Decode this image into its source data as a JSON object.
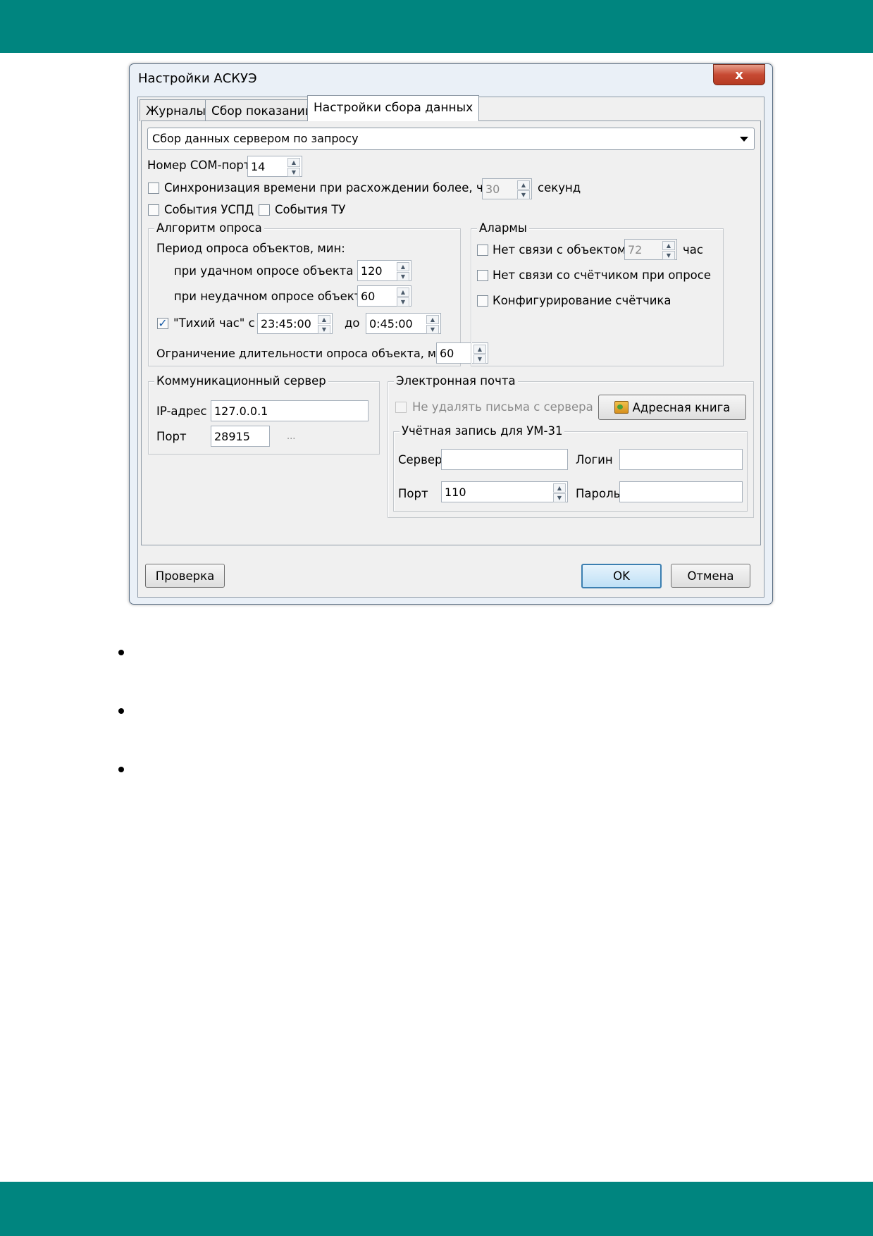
{
  "colors": {
    "brand_bar": "#00857f",
    "default_button": "#3c7fb1"
  },
  "window": {
    "title": "Настройки АСКУЭ",
    "close_label": "x",
    "tabs": [
      {
        "label": "Журналы"
      },
      {
        "label": "Сбор показаний"
      },
      {
        "label": "Настройки сбора данных",
        "active": true
      }
    ]
  },
  "collect": {
    "mode_selected": "Сбор данных сервером по запросу",
    "com_port_label": "Номер COM-порта",
    "com_port_value": "14",
    "sync_label": "Синхронизация времени при расхождении более, чем на",
    "sync_value": "30",
    "sync_unit": "секунд",
    "uspd_events_label": "События УСПД",
    "tu_events_label": "События ТУ"
  },
  "algorithm": {
    "title": "Алгоритм опроса",
    "period_label": "Период опроса объектов, мин:",
    "success_label": "при удачном опросе объекта",
    "success_value": "120",
    "fail_label": "при неудачном опросе объекта",
    "fail_value": "60",
    "quiet_label": "\"Тихий час\" с",
    "quiet_from": "23:45:00",
    "quiet_to_label": "до",
    "quiet_to": "0:45:00",
    "limit_label": "Ограничение длительности опроса объекта, мин",
    "limit_value": "60"
  },
  "alarms": {
    "title": "Алармы",
    "no_link_label": "Нет связи с объектом",
    "no_link_value": "72",
    "no_link_unit": "час",
    "no_meter_label": "Нет связи со счётчиком при опросе",
    "config_meter_label": "Конфигурирование счётчика"
  },
  "comm_server": {
    "title": "Коммуникационный сервер",
    "ip_label": "IP-адрес",
    "ip_value": "127.0.0.1",
    "port_label": "Порт",
    "port_value": "28915",
    "ellipsis": "..."
  },
  "email": {
    "title": "Электронная почта",
    "keep_label": "Не удалять письма с сервера",
    "address_book_label": "Адресная книга",
    "account_title": "Учётная запись для УМ-31",
    "server_label": "Сервер",
    "server_value": "",
    "login_label": "Логин",
    "login_value": "",
    "port_label": "Порт",
    "port_value": "110",
    "password_label": "Пароль",
    "password_value": ""
  },
  "buttons": {
    "check": "Проверка",
    "ok": "OK",
    "cancel": "Отмена"
  }
}
